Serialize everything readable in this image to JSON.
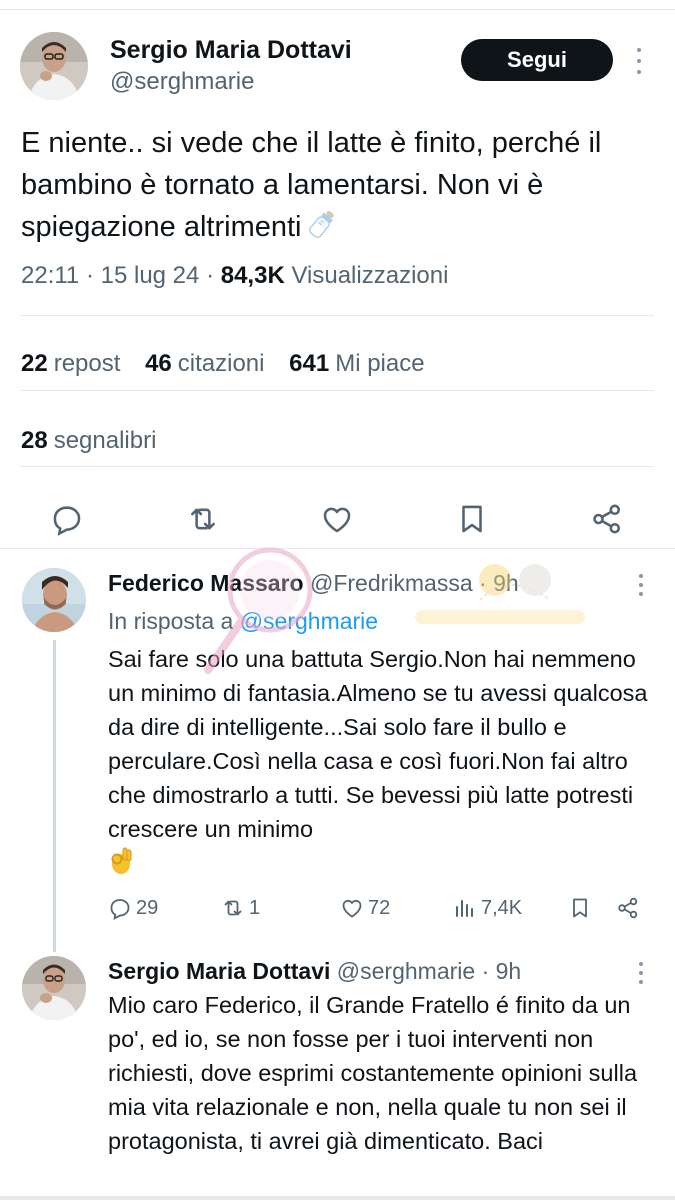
{
  "main_tweet": {
    "author_name": "Sergio Maria Dottavi",
    "author_handle": "@serghmarie",
    "follow_label": "Segui",
    "text": "E niente.. si vede che il latte è finito, perché il bambino è tornato a lamentarsi. Non vi è spiegazione altrimenti",
    "emoji": "baby-bottle",
    "time": "22:11",
    "date": "15 lug 24",
    "views_count": "84,3K",
    "views_label": "Visualizzazioni",
    "reposts_count": "22",
    "reposts_label": "repost",
    "quotes_count": "46",
    "quotes_label": "citazioni",
    "likes_count": "641",
    "likes_label": "Mi piace",
    "bookmarks_count": "28",
    "bookmarks_label": "segnalibri",
    "actions": [
      "reply-icon",
      "repost-icon",
      "like-icon",
      "bookmark-icon",
      "share-icon"
    ]
  },
  "replies": [
    {
      "author_name": "Federico Massaro",
      "author_handle": "@Fredrikmassa",
      "time_ago": "9h",
      "reply_to_prefix": "In risposta a",
      "reply_to_handle": "@serghmarie",
      "text": "Sai fare solo una battuta Sergio.Non hai nemmeno un minimo di fantasia.Almeno se tu avessi qualcosa da dire di intelligente...Sai solo fare il bullo e perculare.Così nella casa e così fuori.Non fai altro che dimostrarlo a tutti. Se bevessi più latte potresti crescere un minimo",
      "emoji": "ok-hand",
      "replies_count": "29",
      "reposts_count": "1",
      "likes_count": "72",
      "views_count": "7,4K"
    },
    {
      "author_name": "Sergio Maria Dottavi",
      "author_handle": "@serghmarie",
      "time_ago": "9h",
      "text": "Mio caro Federico, il Grande Fratello é finito da un po', ed io, se non fosse per i tuoi interventi non richiesti, dove esprimi costantemente opinioni sulla mia vita relazionale e non, nella quale tu non sei il protagonista, ti avrei già dimenticato. Baci"
    }
  ],
  "colors": {
    "text": "#0f1419",
    "secondary": "#536471",
    "link": "#1d9bf0",
    "divider": "#e6e9ec",
    "button_bg": "#0f1419"
  }
}
